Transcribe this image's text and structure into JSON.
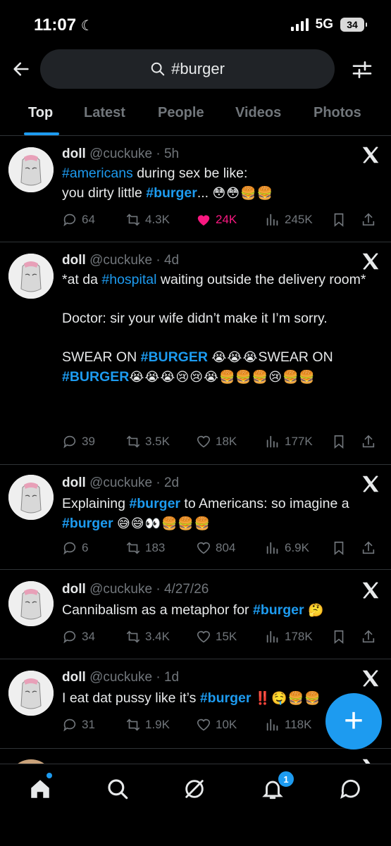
{
  "status": {
    "time": "11:07",
    "network": "5G",
    "battery": "34"
  },
  "search": {
    "query": "#burger"
  },
  "tabs": [
    "Top",
    "Latest",
    "People",
    "Videos",
    "Photos"
  ],
  "tweets": [
    {
      "name": "doll",
      "handle": "@cuckuke",
      "time": "5h",
      "replies": "64",
      "retweets": "4.3K",
      "likes": "24K",
      "views": "245K"
    },
    {
      "name": "doll",
      "handle": "@cuckuke",
      "time": "4d",
      "replies": "39",
      "retweets": "3.5K",
      "likes": "18K",
      "views": "177K"
    },
    {
      "name": "doll",
      "handle": "@cuckuke",
      "time": "2d",
      "replies": "6",
      "retweets": "183",
      "likes": "804",
      "views": "6.9K"
    },
    {
      "name": "doll",
      "handle": "@cuckuke",
      "time": "4/27/26",
      "replies": "34",
      "retweets": "3.4K",
      "likes": "15K",
      "views": "178K"
    },
    {
      "name": "doll",
      "handle": "@cuckuke",
      "time": "1d",
      "replies": "31",
      "retweets": "1.9K",
      "likes": "10K",
      "views": "118K"
    }
  ],
  "text": {
    "t1a": "#americans",
    "t1b": " during sex be like:\nyou dirty little ",
    "t1c": "#burger",
    "t1d": "... ",
    "t2a": "*at da ",
    "t2b": "#hospital",
    "t2c": " waiting outside the delivery room*\n\nDoctor: sir your wife didn’t make it I’m sorry.\n\nSWEAR ON ",
    "t2d": "#BURGER",
    "t2e": " ",
    "t2f": "SWEAR ON ",
    "t2g": "#BURGER",
    "t3a": "Explaining ",
    "t3b": "#burger",
    "t3c": " to Americans: so imagine a ",
    "t3d": "#burger",
    "t3e": " ",
    "t4a": "Cannibalism as a metaphor for ",
    "t4b": "#burger",
    "t4c": " ",
    "t5a": "I eat dat pussy like it’s ",
    "t5b": "#burger",
    "t5c": " "
  },
  "emoji": {
    "e1": "😳😳🍔🍔",
    "e2a": "😭😭😭",
    "e2b": "😭😭😭😢😢😭🍔🍔🍔😢🍔🍔",
    "e3": "😅😅👀🍔🍔🍔",
    "e4": "🤔",
    "e5": "‼️🤤🍔🍔"
  },
  "badges": {
    "notifications": "1"
  },
  "colors": {
    "accent": "#1d9bf0",
    "like": "#f91880",
    "muted": "#71767b",
    "background": "#000000"
  }
}
